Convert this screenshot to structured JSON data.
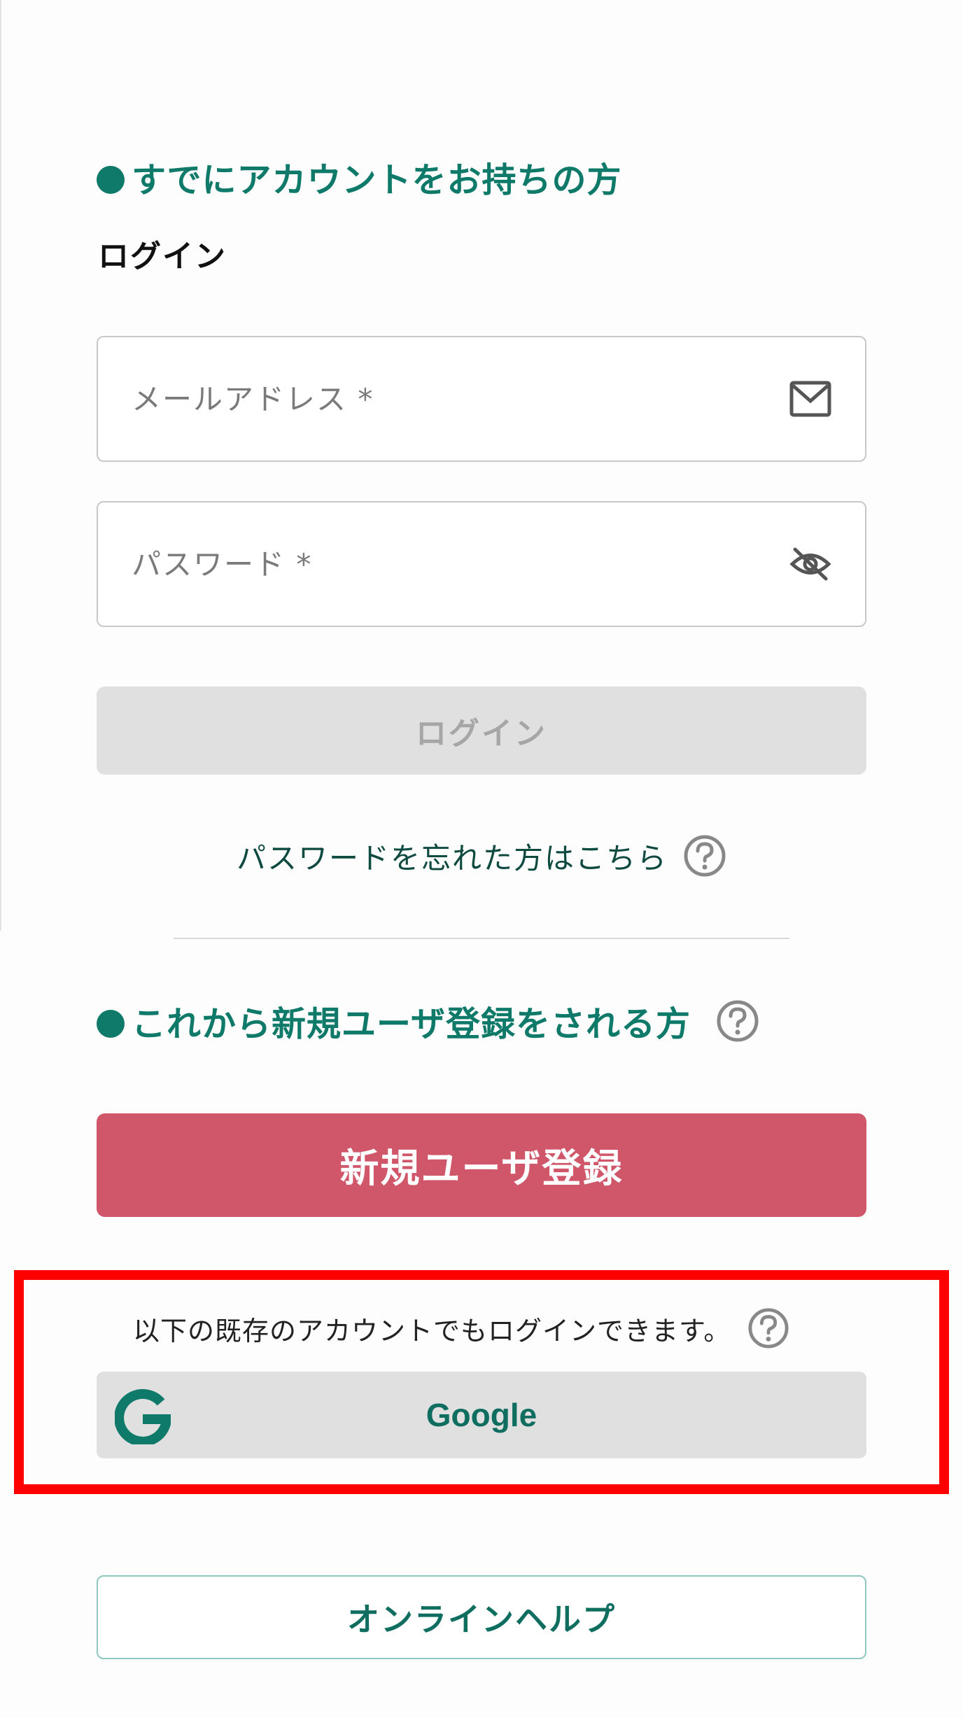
{
  "existing_account": {
    "title": "すでにアカウントをお持ちの方",
    "subtitle": "ログイン",
    "email_placeholder": "メールアドレス *",
    "password_placeholder": "パスワード *",
    "login_button": "ログイン",
    "forgot_password": "パスワードを忘れた方はこちら"
  },
  "new_user": {
    "title": "これから新規ユーザ登録をされる方",
    "register_button": "新規ユーザ登録"
  },
  "sso": {
    "note": "以下の既存のアカウントでもログインできます。",
    "google_button": "Google"
  },
  "online_help_button": "オンラインヘルプ",
  "icons": {
    "email_field": "mail-icon",
    "password_field": "eye-off-icon",
    "help": "question-circle-icon",
    "google": "google-g-icon"
  },
  "colors": {
    "accent_green": "#0f7a69",
    "register_red": "#d0566a",
    "disabled_gray": "#e0e0e0",
    "highlight_red": "#ff0000"
  }
}
